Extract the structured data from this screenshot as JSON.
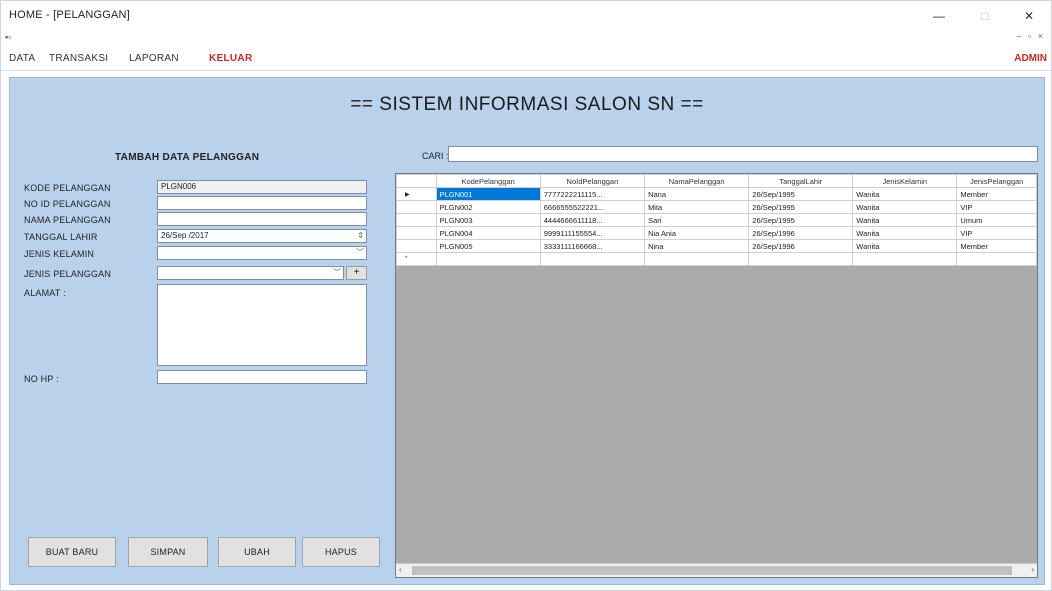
{
  "window": {
    "title": "HOME - [PELANGGAN]",
    "minimize": "—",
    "maximize": "□",
    "close": "✕"
  },
  "mdi": {
    "icon": "▪▫",
    "controls": "– ▫ ×"
  },
  "menu": {
    "items": [
      {
        "label": "DATA"
      },
      {
        "label": "TRANSAKSI"
      },
      {
        "label": "LAPORAN"
      },
      {
        "label": "KELUAR"
      }
    ],
    "user": "ADMIN"
  },
  "main": {
    "heading": "== SISTEM INFORMASI SALON SN ==",
    "form_title": "TAMBAH DATA PELANGGAN",
    "labels": {
      "kode": "KODE PELANGGAN",
      "no_id": "NO ID PELANGGAN",
      "nama": "NAMA PELANGGAN",
      "tanggal": "TANGGAL LAHIR",
      "jenis_kelamin": "JENIS KELAMIN",
      "jenis_pelanggan": "JENIS PELANGGAN",
      "alamat": "ALAMAT :",
      "no_hp": "NO HP :"
    },
    "values": {
      "kode": "PLGN006",
      "no_id": "",
      "nama": "",
      "tanggal": "26/Sep /2017",
      "jenis_kelamin": "",
      "jenis_pelanggan": "",
      "alamat": "",
      "no_hp": ""
    },
    "plus_button": "+",
    "search_label": "CARI :",
    "search_value": "",
    "buttons": {
      "new": "BUAT BARU",
      "save": "SIMPAN",
      "edit": "UBAH",
      "delete": "HAPUS"
    }
  },
  "grid": {
    "columns": [
      "KodePelanggan",
      "NoIdPelanggan",
      "NamaPelanggan",
      "TanggalLahir",
      "JenisKelamin",
      "JenisPelanggan"
    ],
    "rows": [
      [
        "PLGN001",
        "7777222211115...",
        "Nana",
        "26/Sep/1995",
        "Wanita",
        "Member"
      ],
      [
        "PLGN002",
        "6666555522221...",
        "Mita",
        "26/Sep/1995",
        "Wanita",
        "VIP"
      ],
      [
        "PLGN003",
        "4444666611118...",
        "Sari",
        "26/Sep/1995",
        "Wanita",
        "Umum"
      ],
      [
        "PLGN004",
        "9999111155554...",
        "Nia Ania",
        "26/Sep/1996",
        "Wanita",
        "VIP"
      ],
      [
        "PLGN005",
        "3333111166668...",
        "Nina",
        "26/Sep/1996",
        "Wanita",
        "Member"
      ]
    ],
    "current_row_marker": "▶",
    "new_row_marker": "*"
  }
}
